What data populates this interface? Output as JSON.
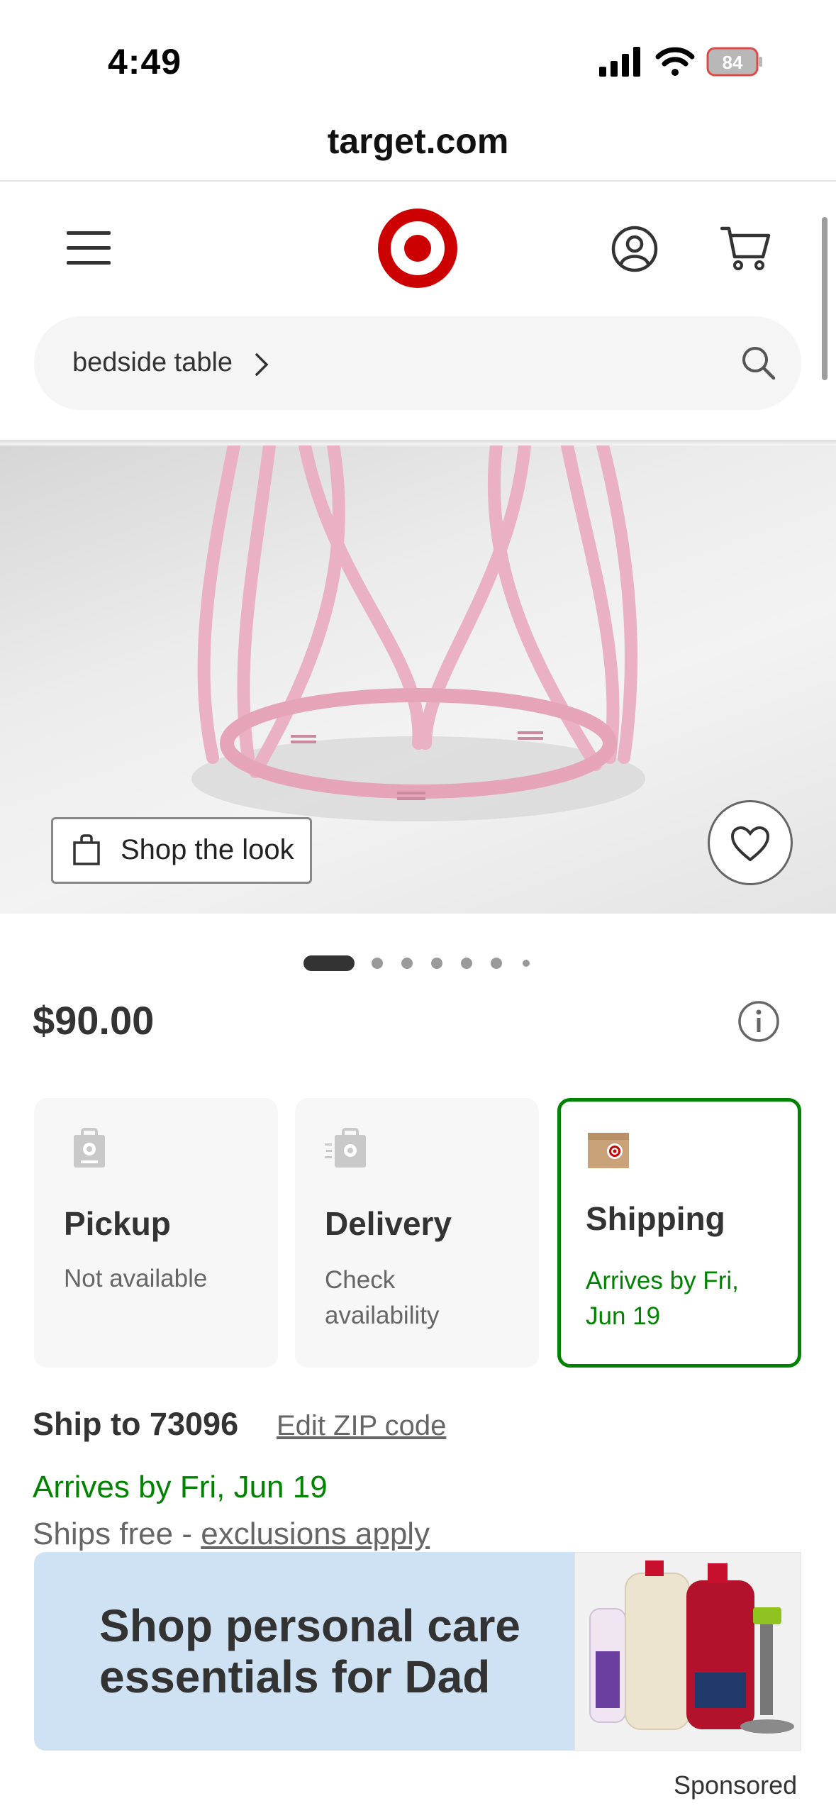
{
  "status_bar": {
    "time": "4:49",
    "battery": "84"
  },
  "browser": {
    "url": "target.com"
  },
  "search": {
    "query": "bedside table"
  },
  "product": {
    "price": "$90.00"
  },
  "hero": {
    "shop_the_look": "Shop the look"
  },
  "carousel": {
    "total_dots": 7,
    "active_index": 0
  },
  "fulfillment": [
    {
      "title": "Pickup",
      "status": "Not available",
      "selected": false
    },
    {
      "title": "Delivery",
      "status_line1": "Check",
      "status_line2": "availability",
      "selected": false
    },
    {
      "title": "Shipping",
      "status_line1": "Arrives by Fri,",
      "status_line2": "Jun 19",
      "selected": true
    }
  ],
  "shipping": {
    "ship_to": "Ship to 73096",
    "edit_zip": "Edit ZIP code",
    "arrives": "Arrives by Fri, Jun 19",
    "ships_free_prefix": "Ships free - ",
    "exclusions": "exclusions apply"
  },
  "ad": {
    "line1": "Shop personal care",
    "line2": "essentials for Dad",
    "sponsored": "Sponsored"
  },
  "colors": {
    "brand_red": "#cc0000",
    "green": "#008300",
    "ad_bg": "#cfe2f3"
  }
}
